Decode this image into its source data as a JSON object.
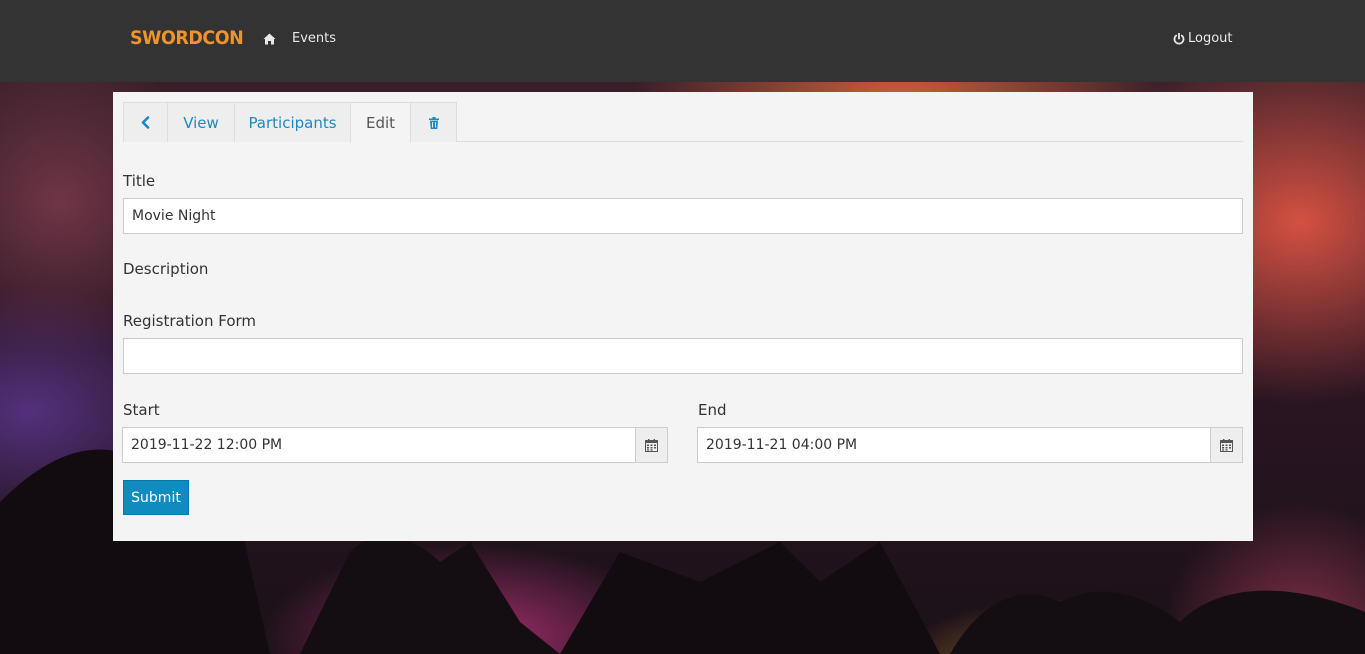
{
  "navbar": {
    "brand": "SWORDCON",
    "events_label": "Events",
    "logout_label": "Logout"
  },
  "tabs": {
    "back_icon": "chevron-left-icon",
    "view_label": "View",
    "participants_label": "Participants",
    "edit_label": "Edit",
    "delete_icon": "trash-icon",
    "active": "Edit"
  },
  "form": {
    "title_label": "Title",
    "title_value": "Movie Night",
    "description_label": "Description",
    "registration_label": "Registration Form",
    "registration_value": "",
    "start_label": "Start",
    "start_value": "2019-11-22 12:00 PM",
    "end_label": "End",
    "end_value": "2019-11-21 04:00 PM",
    "submit_label": "Submit"
  },
  "colors": {
    "navbar_bg": "#333333",
    "brand": "#f0932b",
    "link": "#1a8ac2",
    "primary_button": "#0f8bc0",
    "panel_bg": "#f4f4f4"
  }
}
